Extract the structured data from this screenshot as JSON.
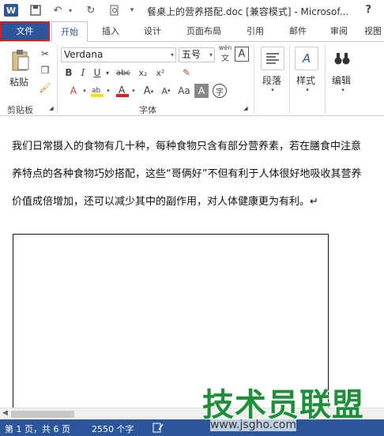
{
  "window": {
    "title": "餐桌上的营养搭配.doc [兼容模式] - Microsof...",
    "help": "?"
  },
  "tabs": [
    {
      "label": "文件"
    },
    {
      "label": "开始"
    },
    {
      "label": "插入"
    },
    {
      "label": "设计"
    },
    {
      "label": "页面布局"
    },
    {
      "label": "引用"
    },
    {
      "label": "邮件"
    },
    {
      "label": "审阅"
    },
    {
      "label": "视图"
    }
  ],
  "ribbon": {
    "paste_label": "粘贴",
    "clipboard_group": "剪贴板",
    "font_name": "Verdana",
    "font_size": "五号",
    "wen": "wén",
    "font_group": "字体",
    "paragraph_label": "段落",
    "styles_label": "样式",
    "editing_label": "编辑"
  },
  "document": {
    "lines": [
      "我们日常摄入的食物有几十种，每种食物只含有部分营养素，若在膳食中注意",
      "养特点的各种食物巧妙搭配，这些“哥俩好”不但有利于人体很好地吸收其营养",
      "价值成倍增加，还可以减少其中的副作用，对人体健康更为有利。↵"
    ]
  },
  "status": {
    "page": "第 1 页，共 6 页",
    "words": "2550 个字"
  },
  "watermark": {
    "text": "技术员联盟",
    "url": "www.jsgho.com"
  },
  "colors": {
    "brand": "#2b579a",
    "file_tab_outline": "#d31f1f",
    "watermark": "#1f8f3b"
  }
}
